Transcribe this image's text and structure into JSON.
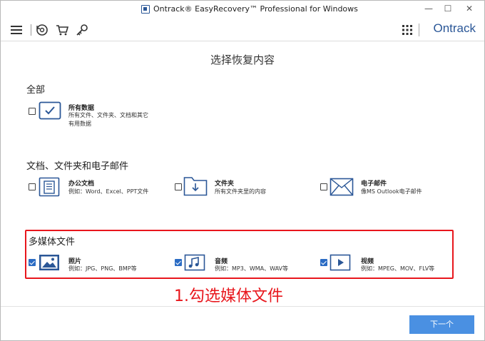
{
  "window": {
    "title": "Ontrack® EasyRecovery™ Professional for Windows",
    "minimize": "—",
    "maximize": "☐",
    "close": "✕"
  },
  "toolbar": {
    "brand": "Ontrack",
    "icons": [
      "menu-icon",
      "scan-history-icon",
      "cart-icon",
      "key-icon",
      "apps-grid-icon"
    ]
  },
  "page": {
    "title": "选择恢复内容"
  },
  "sections": {
    "all": {
      "title": "全部",
      "items": [
        {
          "label": "所有数据",
          "desc1": "所有文件、文件夹、文档和其它",
          "desc2": "有用数据",
          "checked": false
        }
      ]
    },
    "docs": {
      "title": "文档、文件夹和电子邮件",
      "items": [
        {
          "label": "办公文档",
          "desc1": "例如：Word、Excel、PPT文件",
          "checked": false
        },
        {
          "label": "文件夹",
          "desc1": "所有文件夹里的内容",
          "checked": false
        },
        {
          "label": "电子邮件",
          "desc1": "像MS Outlook电子邮件",
          "checked": false
        }
      ]
    },
    "media": {
      "title": "多媒体文件",
      "items": [
        {
          "label": "照片",
          "desc1": "例如：JPG、PNG、BMP等",
          "checked": true
        },
        {
          "label": "音频",
          "desc1": "例如：MP3、WMA、WAV等",
          "checked": true
        },
        {
          "label": "视频",
          "desc1": "例如：MPEG、MOV、FLV等",
          "checked": true
        }
      ]
    }
  },
  "annotation": "1.勾选媒体文件",
  "footer": {
    "next_label": "下一个"
  },
  "colors": {
    "accent": "#2b5797",
    "button": "#4a90e2",
    "highlight": "#e8161c"
  }
}
